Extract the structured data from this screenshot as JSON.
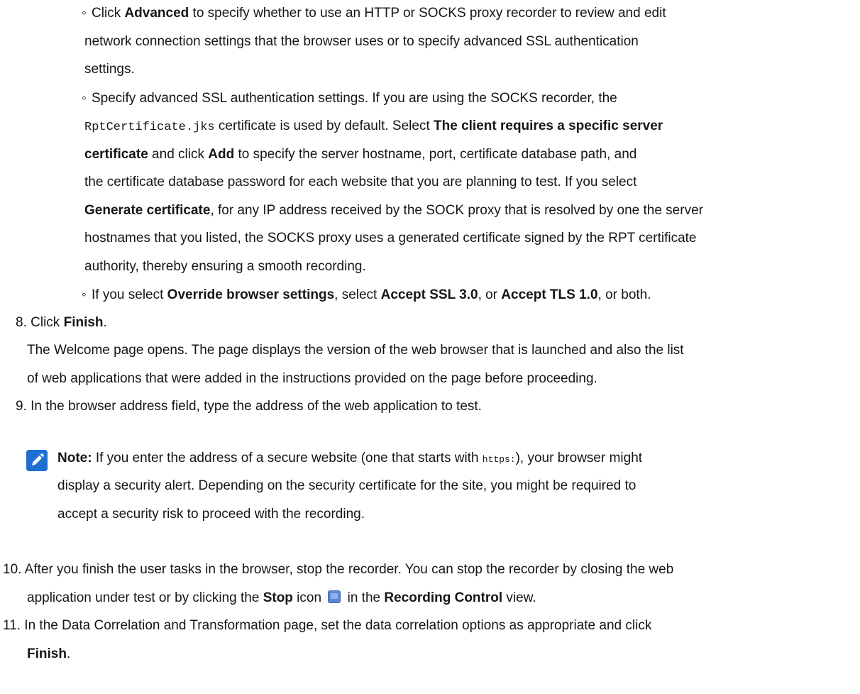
{
  "bullet_glyph": "◦",
  "sub_items": {
    "advanced": {
      "t1": "Click ",
      "b1": "Advanced",
      "t2": " to specify whether to use an HTTP or SOCKS proxy recorder to review and edit",
      "l2": "network connection settings that the browser uses or to specify advanced SSL authentication",
      "l3": "settings."
    },
    "ssl": {
      "l1": "Specify advanced SSL authentication settings. If you are using the SOCKS recorder, the",
      "l2_code": "RptCertificate.jks",
      "l2_t1": " certificate is used by default. Select ",
      "l2_b1": "The client requires a specific server",
      "l3_b1": "certificate",
      "l3_t1": " and click ",
      "l3_b2": "Add",
      "l3_t2": " to specify the server hostname, port, certificate database path, and",
      "l4": "the certificate database password for each website that you are planning to test. If you select",
      "l5_b1": "Generate certificate",
      "l5_t1": ", for any IP address received by the SOCK proxy that is resolved by one the server",
      "l6": "hostnames that you listed, the SOCKS proxy uses a generated certificate signed by the RPT certificate",
      "l7": "authority, thereby ensuring a smooth recording."
    },
    "override": {
      "t1": "If you select ",
      "b1": "Override browser settings",
      "t2": ", select ",
      "b2": "Accept SSL 3.0",
      "t3": ", or ",
      "b3": "Accept TLS 1.0",
      "t4": ", or both."
    }
  },
  "steps": {
    "s8": {
      "num": "8.",
      "t1": "Click ",
      "b1": "Finish",
      "t2": ".",
      "r1": "The Welcome page opens. The page displays the version of the web browser that is launched and also the list",
      "r2": "of web applications that were added in the instructions provided on the page before proceeding."
    },
    "s9": {
      "num": "9.",
      "text": "In the browser address field, type the address of the web application to test."
    },
    "note": {
      "label": "Note:",
      "t1": " If you enter the address of a secure website (one that starts with ",
      "code": "https:",
      "t2": "), your browser might",
      "l2": "display a security alert. Depending on the security certificate for the site, you might be required to",
      "l3": "accept a security risk to proceed with the recording."
    },
    "s10": {
      "num": "10.",
      "l1": "After you finish the user tasks in the browser, stop the recorder. You can stop the recorder by closing the web",
      "l2_t1": "application under test or by clicking the ",
      "l2_b1": "Stop",
      "l2_t2": " icon ",
      "l2_t3": " in the ",
      "l2_b2": "Recording Control",
      "l2_t4": " view."
    },
    "s11": {
      "num": "11.",
      "l1": "In the Data Correlation and Transformation page, set the data correlation options as appropriate and click",
      "l2_b1": "Finish",
      "l2_t1": "."
    }
  }
}
